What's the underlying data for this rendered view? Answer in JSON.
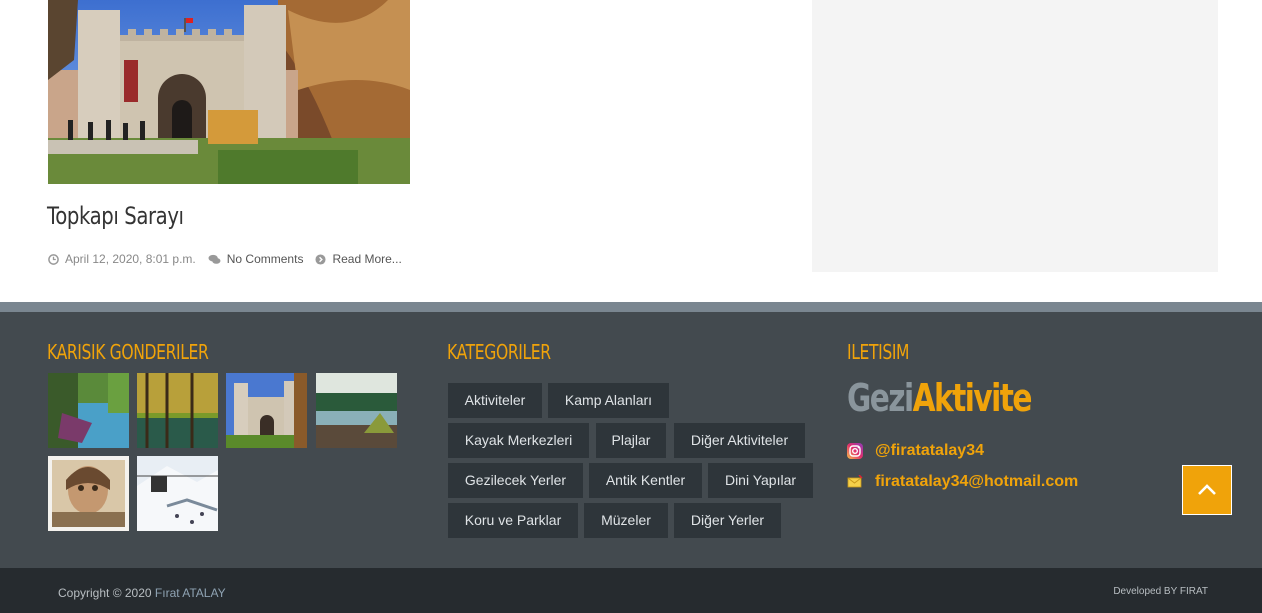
{
  "post": {
    "image_alt": "Topkapı Sarayı",
    "title": "Topkapı Sarayı",
    "date": "April 12, 2020, 8:01 p.m.",
    "comments": "No Comments",
    "read_more": "Read More..."
  },
  "footer": {
    "mixed_heading": "KARISIK GONDERILER",
    "categories_heading": "KATEGORILER",
    "contact_heading": "ILETISIM",
    "categories": [
      "Aktiviteler",
      "Kamp Alanları",
      "Kayak Merkezleri",
      "Plajlar",
      "Diğer Aktiviteler",
      "Gezilecek Yerler",
      "Antik Kentler",
      "Dini Yapılar",
      "Koru ve Parklar",
      "Müzeler",
      "Diğer Yerler"
    ],
    "brand_gezi": "Gezi",
    "brand_aktivite": "Aktivite",
    "instagram": "@firatatalay34",
    "email": "firatatalay34@hotmail.com"
  },
  "bottom": {
    "copyright_prefix": "Copyright © 2020",
    "copyright_name": "Fırat ATALAY",
    "developed": "Developed BY FIRAT"
  },
  "colors": {
    "accent": "#f0a30a",
    "footer_bg": "#434a4f",
    "bottom_bg": "#262b2f"
  },
  "icons": {
    "clock": "clock-icon",
    "comments": "comments-icon",
    "read_more": "arrow-circle-icon",
    "instagram": "instagram-icon",
    "email": "envelope-icon",
    "to_top": "chevron-up-icon"
  }
}
